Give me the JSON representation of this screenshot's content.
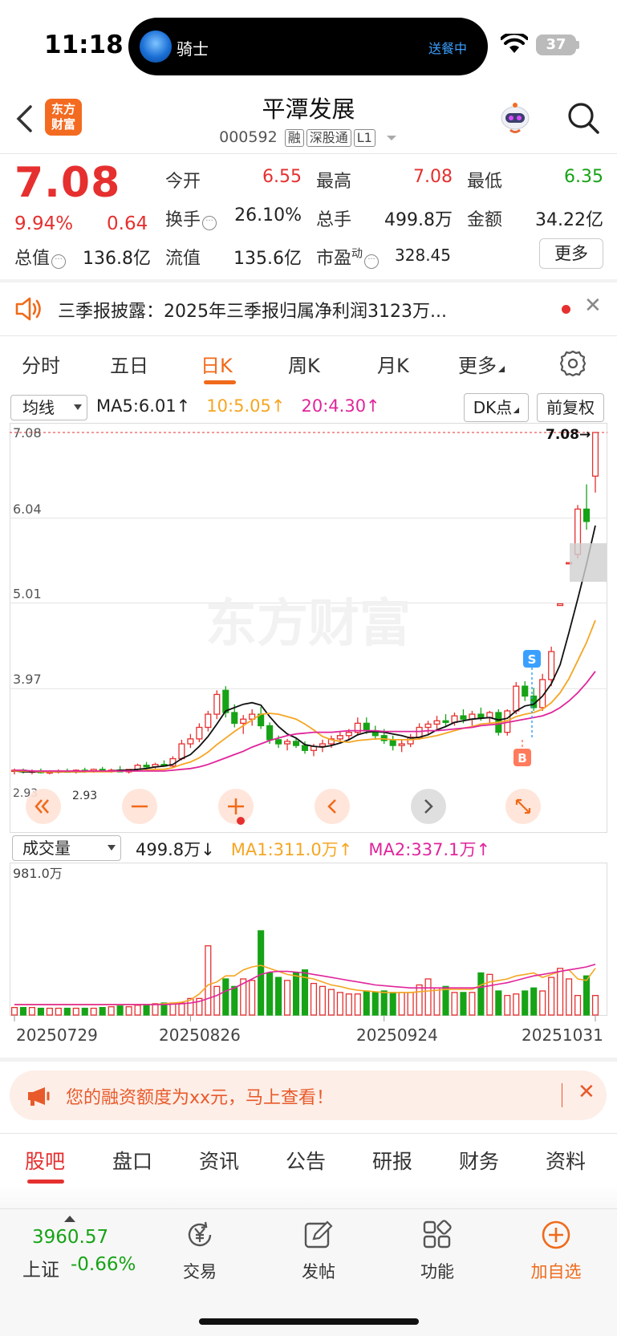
{
  "status_bar": {
    "time": "11:18",
    "rider_label": "骑士",
    "delivery_status": "送餐中",
    "battery": "37"
  },
  "header": {
    "brand_logo_line1": "东方",
    "brand_logo_line2": "财富",
    "stock_name": "平潭发展",
    "stock_code": "000592",
    "tags": [
      "融",
      "深股通",
      "L1"
    ]
  },
  "quote": {
    "last_price": "7.08",
    "change_pct": "9.94%",
    "change_value": "0.64",
    "fields": {
      "open_label": "今开",
      "open": "6.55",
      "high_label": "最高",
      "high": "7.08",
      "low_label": "最低",
      "low": "6.35",
      "turnover_label": "换手",
      "turnover": "26.10%",
      "volume_label": "总手",
      "volume": "499.8万",
      "amount_label": "金额",
      "amount": "34.22亿",
      "mktcap_label": "总值",
      "mktcap": "136.8亿",
      "float_label": "流值",
      "float_cap": "135.6亿",
      "pe_label": "市盈",
      "pe_sup": "动",
      "pe": "328.45"
    },
    "more_label": "更多"
  },
  "notice": {
    "text": "三季报披露：2025年三季报归属净利润3123万..."
  },
  "chart_tabs": [
    "分时",
    "五日",
    "日K",
    "周K",
    "月K",
    "更多"
  ],
  "chart_tab_active": "日K",
  "kline": {
    "indicator": "均线",
    "ma5": "MA5:6.01↑",
    "ma10": "10:5.05↑",
    "ma20": "20:4.30↑",
    "dk_label": "DK点",
    "adj_label": "前复权",
    "last_price_marker": "7.08→",
    "watermark": "东方财富",
    "signal_s": "S",
    "signal_b": "B",
    "low_labels": [
      "2.93",
      "2.93"
    ]
  },
  "volume_panel": {
    "indicator": "成交量",
    "value": "499.8万↓",
    "ma1": "MA1:311.0万↑",
    "ma2": "MA2:337.1万↑",
    "max_label": "981.0万"
  },
  "chart_data": [
    {
      "type": "candlestick",
      "price_axis_labels": [
        "7.08",
        "6.04",
        "5.01",
        "3.97",
        "2.93"
      ],
      "ylim": [
        2.93,
        7.08
      ],
      "dates": [
        "20250729",
        "20250826",
        "20250924",
        "20251031"
      ],
      "candles_ohlc": [
        [
          2.97,
          3.0,
          2.93,
          2.98
        ],
        [
          2.98,
          3.0,
          2.94,
          2.96
        ],
        [
          2.96,
          2.99,
          2.93,
          2.97
        ],
        [
          2.97,
          3.0,
          2.94,
          2.95
        ],
        [
          2.95,
          2.98,
          2.93,
          2.96
        ],
        [
          2.96,
          2.99,
          2.94,
          2.97
        ],
        [
          2.97,
          3.0,
          2.95,
          2.96
        ],
        [
          2.96,
          2.99,
          2.94,
          2.98
        ],
        [
          2.98,
          3.01,
          2.95,
          2.97
        ],
        [
          2.97,
          3.0,
          2.95,
          2.99
        ],
        [
          2.99,
          3.02,
          2.96,
          2.97
        ],
        [
          2.97,
          3.0,
          2.95,
          2.98
        ],
        [
          2.98,
          3.03,
          2.96,
          2.96
        ],
        [
          2.96,
          2.99,
          2.94,
          2.99
        ],
        [
          2.99,
          3.06,
          2.97,
          3.04
        ],
        [
          3.04,
          3.08,
          3.0,
          3.02
        ],
        [
          3.02,
          3.07,
          2.99,
          3.05
        ],
        [
          3.05,
          3.1,
          3.02,
          3.03
        ],
        [
          3.03,
          3.15,
          3.01,
          3.12
        ],
        [
          3.12,
          3.35,
          3.1,
          3.3
        ],
        [
          3.3,
          3.42,
          3.25,
          3.36
        ],
        [
          3.36,
          3.55,
          3.32,
          3.5
        ],
        [
          3.5,
          3.7,
          3.45,
          3.66
        ],
        [
          3.66,
          3.95,
          3.6,
          3.9
        ],
        [
          3.95,
          4.0,
          3.62,
          3.68
        ],
        [
          3.68,
          3.78,
          3.5,
          3.55
        ],
        [
          3.55,
          3.65,
          3.42,
          3.6
        ],
        [
          3.6,
          3.72,
          3.52,
          3.66
        ],
        [
          3.66,
          3.75,
          3.48,
          3.52
        ],
        [
          3.52,
          3.56,
          3.3,
          3.35
        ],
        [
          3.35,
          3.4,
          3.25,
          3.3
        ],
        [
          3.3,
          3.36,
          3.22,
          3.33
        ],
        [
          3.33,
          3.38,
          3.25,
          3.28
        ],
        [
          3.28,
          3.33,
          3.18,
          3.22
        ],
        [
          3.22,
          3.3,
          3.15,
          3.27
        ],
        [
          3.27,
          3.35,
          3.2,
          3.3
        ],
        [
          3.3,
          3.4,
          3.25,
          3.36
        ],
        [
          3.36,
          3.45,
          3.3,
          3.4
        ],
        [
          3.4,
          3.48,
          3.35,
          3.44
        ],
        [
          3.44,
          3.62,
          3.4,
          3.55
        ],
        [
          3.55,
          3.62,
          3.42,
          3.46
        ],
        [
          3.46,
          3.52,
          3.35,
          3.4
        ],
        [
          3.4,
          3.48,
          3.3,
          3.34
        ],
        [
          3.34,
          3.4,
          3.22,
          3.28
        ],
        [
          3.28,
          3.35,
          3.2,
          3.3
        ],
        [
          3.3,
          3.42,
          3.26,
          3.38
        ],
        [
          3.38,
          3.55,
          3.35,
          3.5
        ],
        [
          3.5,
          3.58,
          3.42,
          3.54
        ],
        [
          3.54,
          3.64,
          3.48,
          3.58
        ],
        [
          3.58,
          3.66,
          3.5,
          3.56
        ],
        [
          3.56,
          3.68,
          3.52,
          3.64
        ],
        [
          3.64,
          3.72,
          3.55,
          3.6
        ],
        [
          3.6,
          3.7,
          3.52,
          3.66
        ],
        [
          3.66,
          3.74,
          3.58,
          3.62
        ],
        [
          3.62,
          3.7,
          3.55,
          3.68
        ],
        [
          3.68,
          3.72,
          3.4,
          3.44
        ],
        [
          3.44,
          3.72,
          3.4,
          3.7
        ],
        [
          3.7,
          4.05,
          3.66,
          4.0
        ],
        [
          4.0,
          4.06,
          3.82,
          3.88
        ],
        [
          3.88,
          3.98,
          3.7,
          3.74
        ],
        [
          3.74,
          4.15,
          3.7,
          4.08
        ],
        [
          4.08,
          4.48,
          4.0,
          4.42
        ],
        [
          4.98,
          5.0,
          4.98,
          5.0
        ],
        [
          5.5,
          5.5,
          5.5,
          5.5
        ],
        [
          5.6,
          6.2,
          5.55,
          6.15
        ],
        [
          6.15,
          6.45,
          5.9,
          6.0
        ],
        [
          6.55,
          7.08,
          6.35,
          7.08
        ]
      ],
      "ma5": [
        2.97,
        2.96,
        2.96,
        2.96,
        2.96,
        2.96,
        2.96,
        2.96,
        2.96,
        2.97,
        2.97,
        2.97,
        2.98,
        2.98,
        2.99,
        3.0,
        3.02,
        3.03,
        3.05,
        3.12,
        3.17,
        3.27,
        3.39,
        3.54,
        3.7,
        3.74,
        3.78,
        3.8,
        3.77,
        3.63,
        3.51,
        3.42,
        3.37,
        3.29,
        3.27,
        3.26,
        3.28,
        3.31,
        3.35,
        3.41,
        3.44,
        3.45,
        3.44,
        3.42,
        3.4,
        3.37,
        3.38,
        3.41,
        3.47,
        3.51,
        3.56,
        3.58,
        3.6,
        3.61,
        3.62,
        3.59,
        3.61,
        3.7,
        3.76,
        3.78,
        3.88,
        4.03,
        4.26,
        4.65,
        5.06,
        5.48,
        5.95
      ],
      "ma10": [
        2.97,
        2.97,
        2.97,
        2.96,
        2.96,
        2.96,
        2.96,
        2.96,
        2.96,
        2.96,
        2.96,
        2.96,
        2.97,
        2.97,
        2.97,
        2.98,
        2.99,
        2.99,
        3.01,
        3.05,
        3.08,
        3.13,
        3.2,
        3.29,
        3.37,
        3.45,
        3.52,
        3.59,
        3.66,
        3.67,
        3.66,
        3.63,
        3.6,
        3.54,
        3.47,
        3.39,
        3.35,
        3.33,
        3.32,
        3.34,
        3.35,
        3.36,
        3.36,
        3.35,
        3.35,
        3.35,
        3.36,
        3.38,
        3.4,
        3.43,
        3.46,
        3.49,
        3.51,
        3.54,
        3.55,
        3.56,
        3.58,
        3.63,
        3.66,
        3.68,
        3.72,
        3.8,
        3.92,
        4.09,
        4.31,
        4.53,
        4.8
      ],
      "ma20": [
        2.98,
        2.98,
        2.97,
        2.97,
        2.97,
        2.97,
        2.97,
        2.97,
        2.97,
        2.97,
        2.97,
        2.97,
        2.97,
        2.97,
        2.97,
        2.97,
        2.97,
        2.97,
        2.98,
        2.99,
        3.0,
        3.02,
        3.05,
        3.09,
        3.13,
        3.17,
        3.21,
        3.26,
        3.3,
        3.34,
        3.37,
        3.4,
        3.42,
        3.43,
        3.44,
        3.44,
        3.44,
        3.45,
        3.46,
        3.46,
        3.46,
        3.46,
        3.45,
        3.45,
        3.45,
        3.45,
        3.45,
        3.46,
        3.46,
        3.47,
        3.48,
        3.49,
        3.5,
        3.52,
        3.53,
        3.54,
        3.56,
        3.58,
        3.6,
        3.62,
        3.64,
        3.68,
        3.74,
        3.82,
        3.92,
        4.04,
        4.18
      ]
    },
    {
      "type": "bar",
      "title": "成交量",
      "unit": "万",
      "ylim": [
        0,
        981.0
      ],
      "values": [
        50,
        50,
        50,
        45,
        45,
        45,
        45,
        45,
        45,
        45,
        50,
        55,
        60,
        55,
        65,
        70,
        75,
        80,
        80,
        80,
        110,
        110,
        460,
        190,
        240,
        190,
        240,
        230,
        560,
        280,
        250,
        230,
        280,
        300,
        210,
        190,
        170,
        150,
        140,
        140,
        160,
        150,
        160,
        150,
        150,
        150,
        200,
        240,
        180,
        190,
        150,
        150,
        150,
        280,
        270,
        160,
        130,
        140,
        160,
        180,
        160,
        250,
        310,
        240,
        130,
        260,
        130
      ],
      "ma1": [
        70,
        70,
        70,
        70,
        70,
        70,
        70,
        70,
        70,
        70,
        70,
        70,
        70,
        70,
        70,
        70,
        70,
        75,
        80,
        85,
        100,
        140,
        200,
        220,
        260,
        260,
        300,
        320,
        330,
        310,
        290,
        270,
        260,
        250,
        240,
        220,
        200,
        190,
        175,
        165,
        160,
        155,
        150,
        150,
        150,
        150,
        155,
        160,
        165,
        170,
        170,
        170,
        170,
        200,
        220,
        230,
        240,
        260,
        270,
        280,
        250,
        270,
        290,
        300,
        240,
        230,
        311
      ],
      "ma2": [
        70,
        70,
        70,
        70,
        70,
        70,
        70,
        70,
        70,
        70,
        70,
        70,
        70,
        70,
        70,
        70,
        70,
        70,
        72,
        75,
        80,
        90,
        110,
        130,
        160,
        180,
        210,
        240,
        270,
        285,
        290,
        290,
        285,
        280,
        270,
        260,
        250,
        240,
        230,
        220,
        210,
        200,
        195,
        190,
        185,
        180,
        180,
        180,
        180,
        180,
        180,
        180,
        180,
        185,
        195,
        205,
        215,
        230,
        245,
        260,
        270,
        280,
        290,
        300,
        310,
        320,
        337.1
      ]
    }
  ],
  "promo": {
    "text": "您的融资额度为xx元，马上查看！"
  },
  "bottom_tabs": [
    "股吧",
    "盘口",
    "资讯",
    "公告",
    "研报",
    "财务",
    "资料"
  ],
  "bottom_tab_active": "股吧",
  "bottom_bar": {
    "index_value": "3960.57",
    "index_name": "上证",
    "index_change": "-0.66%",
    "nav": [
      {
        "label": "交易",
        "icon": "yen-trade-icon"
      },
      {
        "label": "发帖",
        "icon": "edit-post-icon"
      },
      {
        "label": "功能",
        "icon": "grid-apps-icon"
      },
      {
        "label": "加自选",
        "icon": "add-watchlist-icon"
      }
    ]
  },
  "colors": {
    "up": "#e5302f",
    "down": "#16a316",
    "accent": "#f06a1a",
    "ma10": "#f5a623",
    "ma20": "#e0259b"
  }
}
